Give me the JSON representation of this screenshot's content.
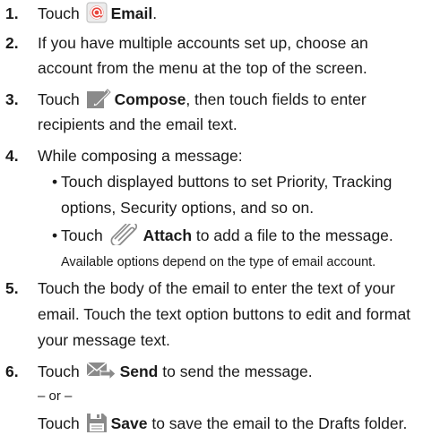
{
  "steps": [
    {
      "num": "1.",
      "pre": "Touch",
      "bold": "Email",
      "post": ".",
      "icon": "email-app-icon"
    },
    {
      "num": "2.",
      "lines": [
        "If you have multiple accounts set up, choose an",
        "account from the menu at the top of the screen."
      ]
    },
    {
      "num": "3.",
      "pre": "Touch",
      "bold": "Compose",
      "post": ", then touch fields to enter",
      "cont": "recipients and the email text.",
      "icon": "compose-icon"
    },
    {
      "num": "4.",
      "text": "While composing a message:",
      "bullets": [
        {
          "lines": [
            "Touch displayed buttons to set Priority, Tracking",
            "options, Security options, and so on."
          ]
        },
        {
          "pre": "Touch",
          "bold": "Attach",
          "post": "to add a file to the message.",
          "icon": "paperclip-icon",
          "note": "Available options depend on the type of email account."
        }
      ]
    },
    {
      "num": "5.",
      "lines": [
        "Touch the body of the email to enter the text of your",
        "email. Touch the text option buttons to edit and format",
        "your message text."
      ]
    },
    {
      "num": "6.",
      "pre": "Touch",
      "bold": "Send",
      "post": "to send the message.",
      "icon": "send-icon",
      "or": "– or –",
      "alt": {
        "pre": "Touch",
        "bold": "Save",
        "post": "to save the email to the Drafts folder.",
        "icon": "save-icon"
      }
    }
  ],
  "colors": {
    "email_icon": "#e8453c",
    "icon_gray": "#8a8a8a"
  }
}
